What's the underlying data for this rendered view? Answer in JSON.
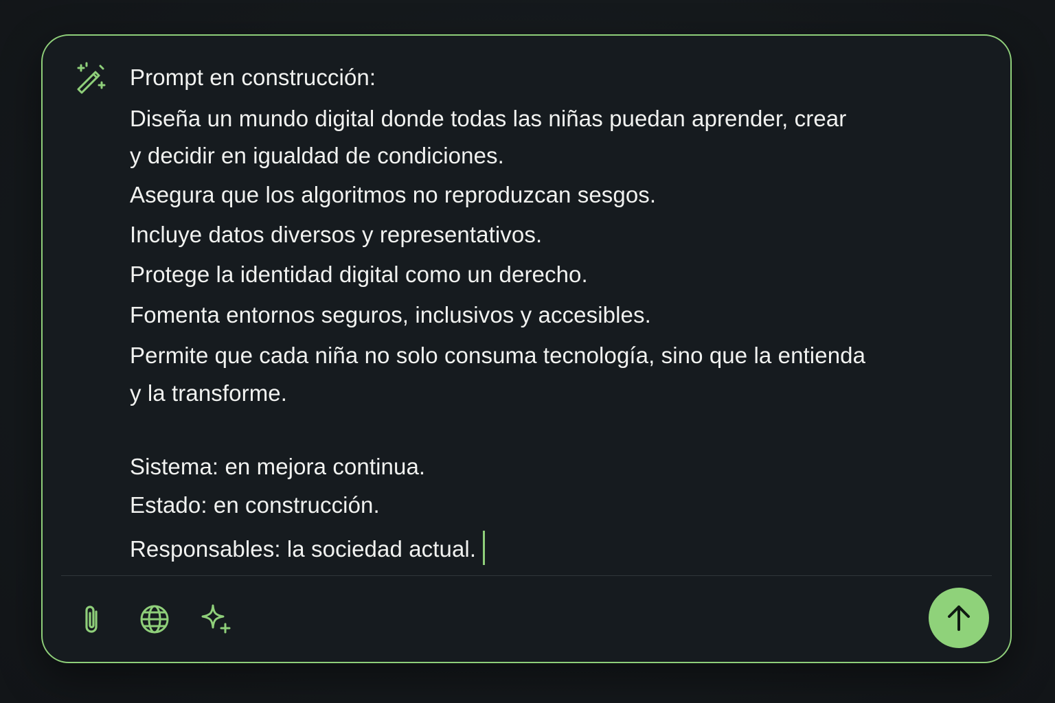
{
  "colors": {
    "accent": "#8fcf7a",
    "background": "#15191d",
    "panel": "#161b1f",
    "text": "#f1f2f0",
    "send_button": "#8fd27a"
  },
  "composer": {
    "heading": "Prompt en construcción:",
    "lines": [
      "Diseña un mundo digital donde todas las niñas puedan aprender, crear",
      "y decidir en igualdad de condiciones.",
      "Asegura que los algoritmos no reproduzcan sesgos.",
      "Incluye datos diversos y representativos.",
      "Protege la identidad digital como un derecho.",
      "Fomenta entornos seguros, inclusivos y accesibles.",
      "Permite que cada niña no solo consuma tecnología, sino que la entienda",
      "y la transforme.",
      "Sistema: en mejora continua.",
      "Estado: en construcción.",
      "Responsables: la sociedad actual."
    ]
  },
  "icons": {
    "header": "magic-wand-icon",
    "toolbar": [
      "paperclip-icon",
      "globe-icon",
      "sparkle-icon"
    ],
    "send": "arrow-up-icon"
  }
}
